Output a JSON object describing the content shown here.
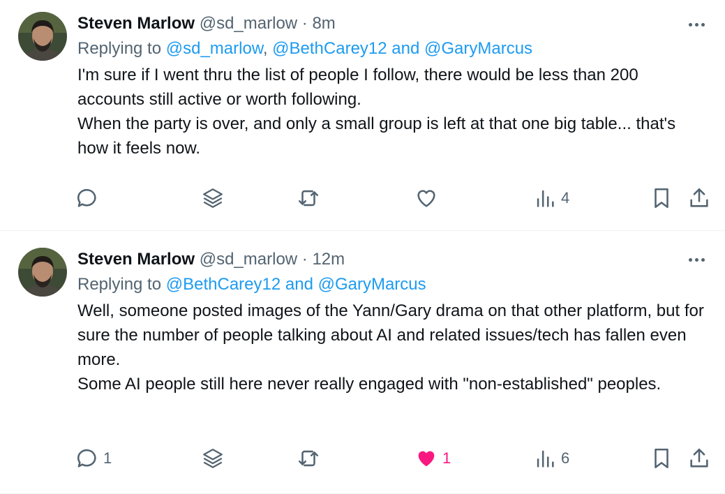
{
  "tweets": [
    {
      "author": "Steven Marlow",
      "handle": "@sd_marlow",
      "time": "· 8m",
      "replying_prefix": "Replying to",
      "replying_to": [
        "@sd_marlow",
        ", ",
        "@BethCarey12 and @GaryMarcus"
      ],
      "body": [
        "I'm sure if I went thru the list of people I follow, there would be less than 200 accounts still active or worth following.",
        "When the party is over, and only a small group is left at that one big table... that's how it feels now."
      ],
      "actions": {
        "reply_count": "",
        "like_count": "",
        "views_count": "4",
        "liked": false
      }
    },
    {
      "author": "Steven Marlow",
      "handle": "@sd_marlow",
      "time": "· 12m",
      "replying_prefix": "Replying to",
      "replying_to": [
        "@BethCarey12 and @GaryMarcus"
      ],
      "body": [
        "Well, someone posted images of the Yann/Gary drama on that other platform, but for sure the number of people talking about AI and related issues/tech has fallen even more.",
        "Some AI people still here never really engaged with \"non-established\" peoples."
      ],
      "actions": {
        "reply_count": "1",
        "like_count": "1",
        "views_count": "6",
        "liked": true
      }
    }
  ],
  "icons": {
    "reply": "speech-bubble-icon",
    "stack": "layers-icon",
    "retweet": "retweet-icon",
    "like": "heart-icon",
    "views": "bar-chart-icon",
    "bookmark": "bookmark-icon",
    "share": "share-upload-icon",
    "more": "more-dots-icon"
  },
  "colors": {
    "link": "#1d9bf0",
    "muted": "#536471",
    "like_active": "#f91880"
  }
}
